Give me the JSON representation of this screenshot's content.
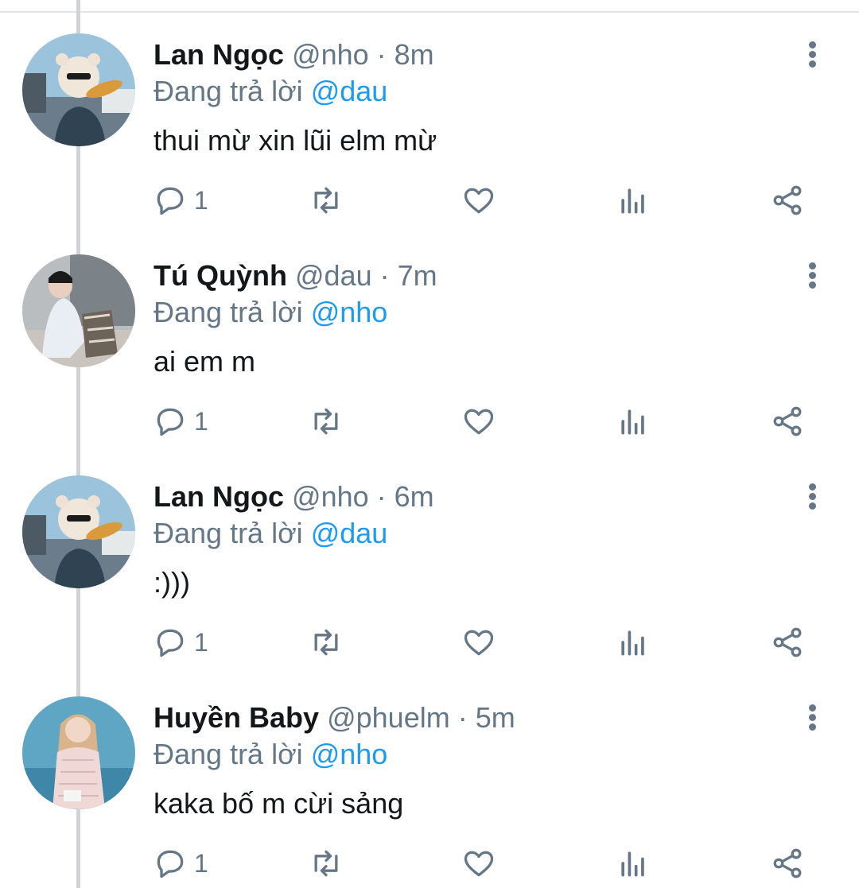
{
  "tweets": [
    {
      "name": "Lan Ngọc",
      "handle": "@nho",
      "time": "· 8m",
      "replying_label": "Đang trả lời",
      "replying_to": "@dau",
      "text": "thui mừ xin lũi elm mừ",
      "reply_count": "1",
      "avatar": "woman-with-bear-hat"
    },
    {
      "name": "Tú Quỳnh",
      "handle": "@dau",
      "time": "· 7m",
      "replying_label": "Đang trả lời",
      "replying_to": "@nho",
      "text": "ai em m",
      "reply_count": "1",
      "avatar": "woman-sitting-city"
    },
    {
      "name": "Lan Ngọc",
      "handle": "@nho",
      "time": "· 6m",
      "replying_label": "Đang trả lời",
      "replying_to": "@dau",
      "text": ":)))",
      "reply_count": "1",
      "avatar": "woman-with-bear-hat"
    },
    {
      "name": "Huyền Baby",
      "handle": "@phuelm",
      "time": "· 5m",
      "replying_label": "Đang trả lời",
      "replying_to": "@nho",
      "text": "kaka bố m cừi sảng",
      "reply_count": "1",
      "avatar": "woman-pink-dress-beach"
    }
  ],
  "colors": {
    "accent": "#1d9bf0",
    "secondary_text": "#657786",
    "primary_text": "#14171a",
    "thread_line": "#cfd3d6"
  },
  "icons": [
    "reply-icon",
    "retweet-icon",
    "like-icon",
    "analytics-icon",
    "share-icon",
    "more-options-icon"
  ]
}
